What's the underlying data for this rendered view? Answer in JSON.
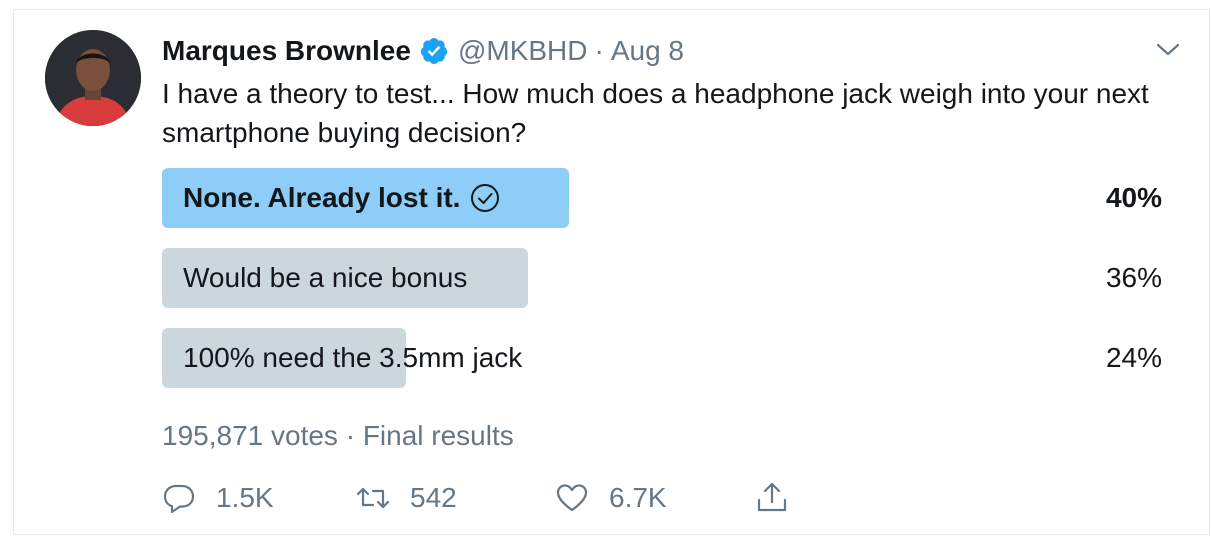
{
  "tweet": {
    "author_name": "Marques Brownlee",
    "handle": "@MKBHD",
    "separator": "·",
    "date": "Aug 8",
    "text": "I have a theory to test... How much does a headphone jack weigh into your next smartphone buying decision?"
  },
  "poll": {
    "options": [
      {
        "label": "None. Already lost it.",
        "percent": "40%",
        "fraction": 0.4,
        "winner": true
      },
      {
        "label": "Would be a nice bonus",
        "percent": "36%",
        "fraction": 0.36,
        "winner": false
      },
      {
        "label": "100% need the 3.5mm jack",
        "percent": "24%",
        "fraction": 0.24,
        "winner": false
      }
    ],
    "votes": "195,871 votes",
    "separator": "·",
    "status": "Final results"
  },
  "actions": {
    "replies": "1.5K",
    "retweets": "542",
    "likes": "6.7K"
  },
  "colors": {
    "verified": "#1da1f2",
    "winner_bar": "#8ecdf7",
    "bar": "#ccd6dd",
    "muted_text": "#657786"
  },
  "icons": [
    "verified-badge-icon",
    "chevron-down-icon",
    "check-circle-icon",
    "reply-icon",
    "retweet-icon",
    "like-icon",
    "share-icon"
  ]
}
